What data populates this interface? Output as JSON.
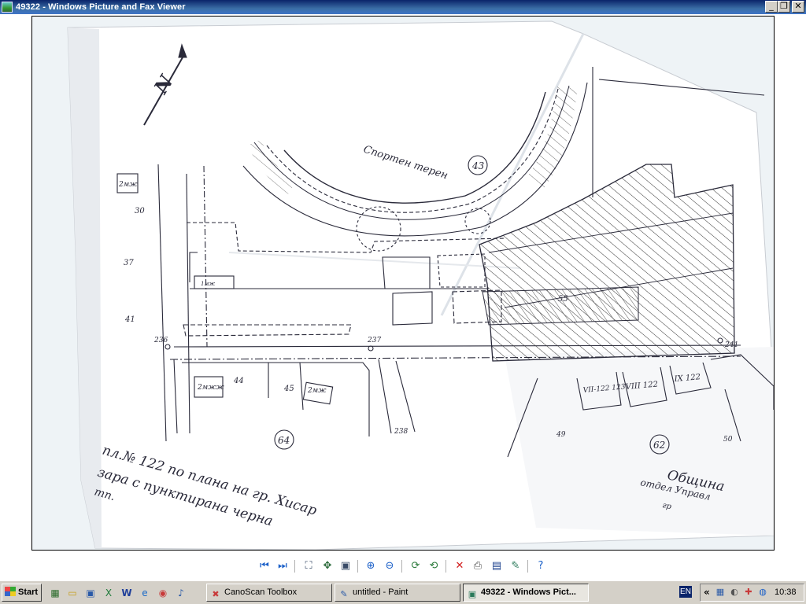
{
  "window": {
    "title": "49322 - Windows Picture and Fax Viewer"
  },
  "map": {
    "stamp_label": "Спортен терен",
    "lot_numbers": [
      "43",
      "64",
      "62"
    ],
    "parcel_numbers": [
      "30",
      "37",
      "41",
      "55",
      "44",
      "45",
      "49",
      "50"
    ],
    "point_numbers": [
      "236",
      "237",
      "238",
      "241"
    ],
    "building_labels": [
      "2мж",
      "2мжж",
      "2мж",
      "1мж"
    ],
    "plot_labels": [
      "VII-122\n123",
      "VIII 122",
      "IX 122"
    ],
    "handwriting_lines": [
      "пл.№ 122 по плана на гр. Хисар",
      "зара с пунктирана черна",
      "тп."
    ],
    "org_lines": [
      "Община",
      "отдел Управл",
      "гр"
    ],
    "north_label": "N"
  },
  "toolbar": {
    "icons": [
      "previous-image-icon",
      "next-image-icon",
      "best-fit-icon",
      "actual-size-icon",
      "slideshow-icon",
      "zoom-in-icon",
      "zoom-out-icon",
      "rotate-clockwise-icon",
      "rotate-counterclockwise-icon",
      "delete-icon",
      "print-icon",
      "save-icon",
      "open-for-editing-icon",
      "help-icon"
    ]
  },
  "taskbar": {
    "start_label": "Start",
    "tasks": [
      {
        "label": "CanoScan Toolbox",
        "icon": "canoscan-icon"
      },
      {
        "label": "untitled - Paint",
        "icon": "paint-icon"
      },
      {
        "label": "49322 - Windows Pict...",
        "icon": "picture-viewer-icon"
      }
    ],
    "language": "EN",
    "clock": "10:38"
  },
  "colors": {
    "titlebar": "#0a246a",
    "taskbar": "#d4d0c8",
    "ink": "#2a2a3a"
  }
}
